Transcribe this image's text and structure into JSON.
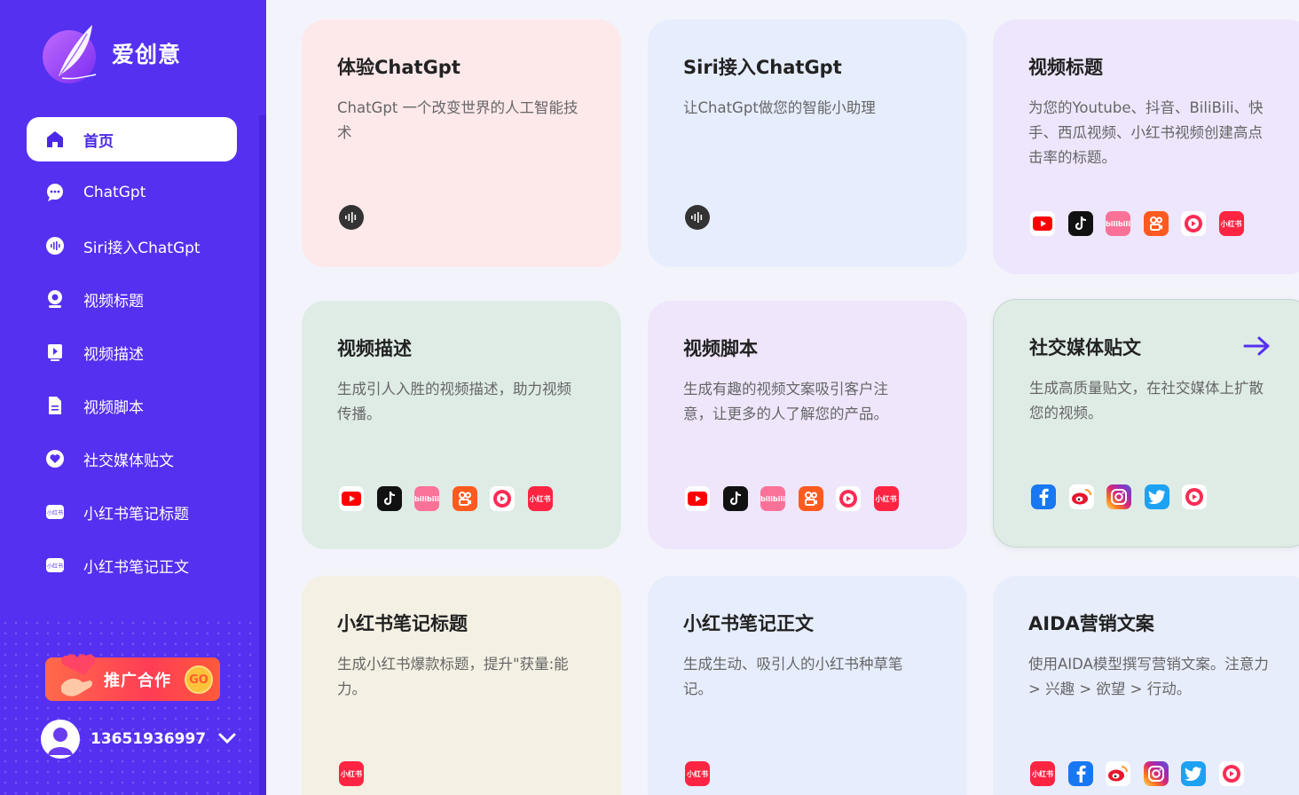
{
  "app": {
    "name": "爱创意"
  },
  "nav": [
    {
      "label": "首页",
      "icon": "home-icon"
    },
    {
      "label": "ChatGpt",
      "icon": "chat-bubble-icon"
    },
    {
      "label": "Siri接入ChatGpt",
      "icon": "voice-wave-icon"
    },
    {
      "label": "视频标题",
      "icon": "webcam-icon"
    },
    {
      "label": "视频描述",
      "icon": "video-file-icon"
    },
    {
      "label": "视频脚本",
      "icon": "document-icon"
    },
    {
      "label": "社交媒体贴文",
      "icon": "heart-bubble-icon"
    },
    {
      "label": "小红书笔记标题",
      "icon": "xiaohongshu-icon"
    },
    {
      "label": "小红书笔记正文",
      "icon": "xiaohongshu-icon"
    }
  ],
  "promo": {
    "label": "推广合作",
    "go": "GO"
  },
  "user": {
    "phone": "13651936997"
  },
  "cards": [
    {
      "title": "体验ChatGpt",
      "desc": "ChatGpt 一个改变世界的人工智能技术",
      "icons": [
        "voice-icon"
      ]
    },
    {
      "title": "Siri接入ChatGpt",
      "desc": "让ChatGpt做您的智能小助理",
      "icons": [
        "voice-icon"
      ]
    },
    {
      "title": "视频标题",
      "desc": "为您的Youtube、抖音、BiliBili、快手、西瓜视频、小红书视频创建高点击率的标题。",
      "icons": [
        "youtube-icon",
        "tiktok-icon",
        "bilibili-icon",
        "kuaishou-icon",
        "xigua-icon",
        "xiaohongshu-icon"
      ]
    },
    {
      "title": "视频描述",
      "desc": "生成引人入胜的视频描述，助力视频传播。",
      "icons": [
        "youtube-icon",
        "tiktok-icon",
        "bilibili-icon",
        "kuaishou-icon",
        "xigua-icon",
        "xiaohongshu-icon"
      ]
    },
    {
      "title": "视频脚本",
      "desc": "生成有趣的视频文案吸引客户注意，让更多的人了解您的产品。",
      "icons": [
        "youtube-icon",
        "tiktok-icon",
        "bilibili-icon",
        "kuaishou-icon",
        "xigua-icon",
        "xiaohongshu-icon"
      ]
    },
    {
      "title": "社交媒体贴文",
      "desc": "生成高质量贴文，在社交媒体上扩散您的视频。",
      "icons": [
        "facebook-icon",
        "weibo-icon",
        "instagram-icon",
        "twitter-icon",
        "xigua-icon"
      ]
    },
    {
      "title": "小红书笔记标题",
      "desc": "生成小红书爆款标题，提升\"获量:能力。",
      "icons": [
        "xiaohongshu-icon"
      ]
    },
    {
      "title": "小红书笔记正文",
      "desc": "生成生动、吸引人的小红书种草笔记。",
      "icons": [
        "xiaohongshu-icon"
      ]
    },
    {
      "title": "AIDA营销文案",
      "desc": "使用AIDA模型撰写营销文案。注意力 > 兴趣 > 欲望 > 行动。",
      "icons": [
        "xiaohongshu-icon",
        "facebook-icon",
        "weibo-icon",
        "instagram-icon",
        "twitter-icon",
        "xigua-icon"
      ]
    }
  ],
  "icon_labels": {
    "bilibili": "bilibili",
    "xiaohongshu": "小红书"
  },
  "colors": {
    "sidebar": "#5530f0",
    "accent": "#4b28e6"
  }
}
